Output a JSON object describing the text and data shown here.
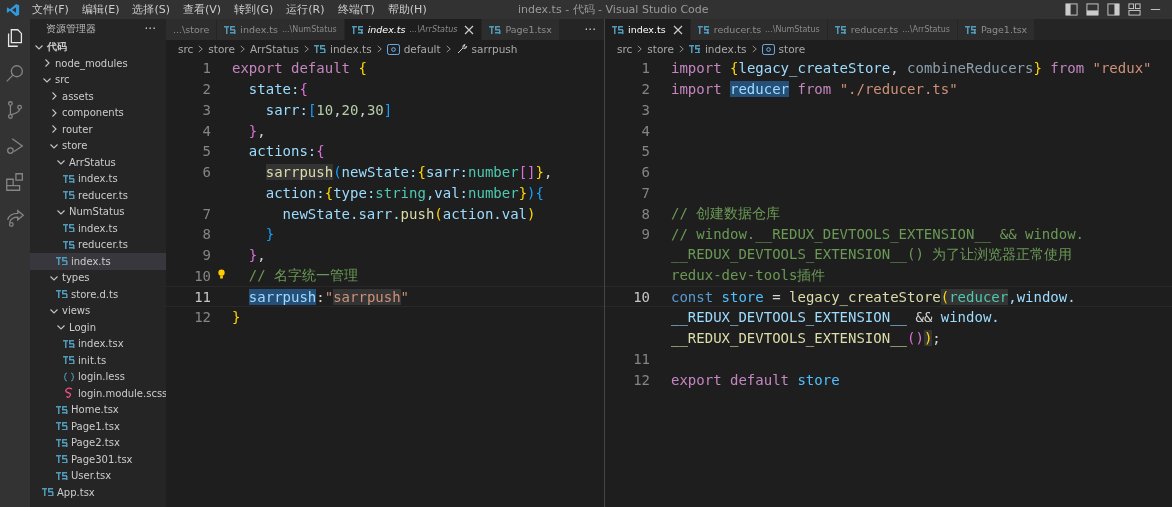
{
  "window": {
    "title": "index.ts - 代码 - Visual Studio Code"
  },
  "menu": [
    "文件(F)",
    "编辑(E)",
    "选择(S)",
    "查看(V)",
    "转到(G)",
    "运行(R)",
    "终端(T)",
    "帮助(H)"
  ],
  "activity_bar": [
    {
      "kind": "explorer",
      "selected": true
    },
    {
      "kind": "search",
      "selected": false
    },
    {
      "kind": "source-control",
      "selected": false
    },
    {
      "kind": "run",
      "selected": false
    },
    {
      "kind": "extensions",
      "selected": false
    },
    {
      "kind": "share",
      "selected": false
    }
  ],
  "sidebar": {
    "title": "资源管理器",
    "more": "···",
    "root": {
      "name": "代码",
      "expanded": true
    },
    "tree": [
      {
        "name": "node_modules",
        "kind": "folder",
        "expanded": false,
        "selected": false
      },
      {
        "name": "src",
        "kind": "folder",
        "expanded": true,
        "selected": false,
        "children": [
          {
            "name": "assets",
            "kind": "folder",
            "expanded": false,
            "selected": false
          },
          {
            "name": "components",
            "kind": "folder",
            "expanded": false,
            "selected": false
          },
          {
            "name": "router",
            "kind": "folder",
            "expanded": false,
            "selected": false
          },
          {
            "name": "store",
            "kind": "folder",
            "expanded": true,
            "selected": false,
            "children": [
              {
                "name": "ArrStatus",
                "kind": "folder",
                "expanded": true,
                "selected": false,
                "children": [
                  {
                    "name": "index.ts",
                    "kind": "ts",
                    "selected": false
                  },
                  {
                    "name": "reducer.ts",
                    "kind": "ts",
                    "selected": false
                  }
                ]
              },
              {
                "name": "NumStatus",
                "kind": "folder",
                "expanded": true,
                "selected": false,
                "children": [
                  {
                    "name": "index.ts",
                    "kind": "ts",
                    "selected": false
                  },
                  {
                    "name": "reducer.ts",
                    "kind": "ts",
                    "selected": false
                  }
                ]
              },
              {
                "name": "index.ts",
                "kind": "ts",
                "selected": true
              }
            ]
          },
          {
            "name": "types",
            "kind": "folder",
            "expanded": true,
            "selected": false,
            "children": [
              {
                "name": "store.d.ts",
                "kind": "ts",
                "selected": false
              }
            ]
          },
          {
            "name": "views",
            "kind": "folder",
            "expanded": true,
            "selected": false,
            "children": [
              {
                "name": "Login",
                "kind": "folder",
                "expanded": true,
                "selected": false,
                "children": [
                  {
                    "name": "index.tsx",
                    "kind": "ts",
                    "selected": false
                  },
                  {
                    "name": "init.ts",
                    "kind": "ts",
                    "selected": false
                  },
                  {
                    "name": "login.less",
                    "kind": "less",
                    "selected": false
                  },
                  {
                    "name": "login.module.scss",
                    "kind": "scss",
                    "selected": false
                  }
                ]
              },
              {
                "name": "Home.tsx",
                "kind": "ts",
                "selected": false
              },
              {
                "name": "Page1.tsx",
                "kind": "ts",
                "selected": false
              },
              {
                "name": "Page2.tsx",
                "kind": "ts",
                "selected": false
              },
              {
                "name": "Page301.tsx",
                "kind": "ts",
                "selected": false
              },
              {
                "name": "User.tsx",
                "kind": "ts",
                "selected": false
              }
            ]
          }
        ]
      },
      {
        "name": "App.tsx",
        "kind": "ts",
        "selected": false
      }
    ]
  },
  "editors": [
    {
      "tabs": [
        {
          "name": "...\\store",
          "icon": false,
          "selected": false,
          "preview": false
        },
        {
          "name": "index.ts",
          "path": "...\\NumStatus",
          "icon": true,
          "selected": false,
          "preview": false
        },
        {
          "name": "index.ts",
          "path": "...\\ArrStatus",
          "icon": true,
          "selected": true,
          "preview": true
        },
        {
          "name": "Page1.tsx",
          "icon": true,
          "selected": false,
          "preview": false
        }
      ],
      "more": "···",
      "breadcrumbs": [
        {
          "text": "src",
          "kind": "folder"
        },
        {
          "text": "store",
          "kind": "folder"
        },
        {
          "text": "ArrStatus",
          "kind": "folder"
        },
        {
          "text": "index.ts",
          "kind": "ts"
        },
        {
          "text": "default",
          "kind": "symbol"
        },
        {
          "text": "sarrpush",
          "kind": "property"
        }
      ],
      "lines": [
        {
          "number": "1",
          "current": false,
          "rows": [
            {
              "tokens": [
                {
                  "text": "export default ",
                  "kind": "kw"
                },
                {
                  "text": "{",
                  "kind": "b1"
                }
              ]
            }
          ]
        },
        {
          "number": "2",
          "current": false,
          "rows": [
            {
              "tokens": [
                {
                  "text": "  state:",
                  "kind": "var"
                },
                {
                  "text": "{",
                  "kind": "b2"
                }
              ]
            }
          ]
        },
        {
          "number": "3",
          "current": false,
          "rows": [
            {
              "tokens": [
                {
                  "text": "    sarr:",
                  "kind": "var"
                },
                {
                  "text": "[",
                  "kind": "b3"
                },
                {
                  "text": "10",
                  "kind": "num"
                },
                {
                  "text": ",",
                  "kind": "plain"
                },
                {
                  "text": "20",
                  "kind": "num"
                },
                {
                  "text": ",",
                  "kind": "plain"
                },
                {
                  "text": "30",
                  "kind": "num"
                },
                {
                  "text": "]",
                  "kind": "b3"
                }
              ]
            }
          ]
        },
        {
          "number": "4",
          "current": false,
          "rows": [
            {
              "tokens": [
                {
                  "text": "  }",
                  "kind": "b2"
                },
                {
                  "text": ",",
                  "kind": "plain"
                }
              ]
            }
          ]
        },
        {
          "number": "5",
          "current": false,
          "rows": [
            {
              "tokens": [
                {
                  "text": "  actions:",
                  "kind": "var"
                },
                {
                  "text": "{",
                  "kind": "b2"
                }
              ]
            }
          ]
        },
        {
          "number": "6",
          "current": false,
          "rows": [
            {
              "tokens": [
                {
                  "text": "    sarrpush",
                  "kind": "fn-hl"
                },
                {
                  "text": "(",
                  "kind": "b3"
                },
                {
                  "text": "newState:",
                  "kind": "var"
                },
                {
                  "text": "{",
                  "kind": "b1"
                },
                {
                  "text": "sarr:",
                  "kind": "var"
                },
                {
                  "text": "number",
                  "kind": "type"
                },
                {
                  "text": "[]",
                  "kind": "b2"
                },
                {
                  "text": "}",
                  "kind": "b1"
                },
                {
                  "text": ",",
                  "kind": "plain"
                }
              ]
            },
            {
              "tokens": [
                {
                  "text": "    action:",
                  "kind": "var"
                },
                {
                  "text": "{",
                  "kind": "b1"
                },
                {
                  "text": "type:",
                  "kind": "var"
                },
                {
                  "text": "string",
                  "kind": "type"
                },
                {
                  "text": ",val:",
                  "kind": "var"
                },
                {
                  "text": "number",
                  "kind": "type"
                },
                {
                  "text": "}",
                  "kind": "b1"
                },
                {
                  "text": ")",
                  "kind": "b3"
                },
                {
                  "text": "{",
                  "kind": "b3"
                }
              ]
            }
          ]
        },
        {
          "number": "7",
          "current": false,
          "rows": [
            {
              "tokens": [
                {
                  "text": "      newState.sarr.",
                  "kind": "var"
                },
                {
                  "text": "push",
                  "kind": "fn"
                },
                {
                  "text": "(",
                  "kind": "b1"
                },
                {
                  "text": "action.val",
                  "kind": "var"
                },
                {
                  "text": ")",
                  "kind": "b1"
                }
              ]
            }
          ]
        },
        {
          "number": "8",
          "current": false,
          "rows": [
            {
              "tokens": [
                {
                  "text": "    }",
                  "kind": "b3"
                }
              ]
            }
          ]
        },
        {
          "number": "9",
          "current": false,
          "rows": [
            {
              "tokens": [
                {
                  "text": "  }",
                  "kind": "b2"
                },
                {
                  "text": ",",
                  "kind": "plain"
                }
              ]
            }
          ]
        },
        {
          "number": "10",
          "current": false,
          "bulb": true,
          "rows": [
            {
              "tokens": [
                {
                  "text": "  // 名字统一管理",
                  "kind": "cmt"
                }
              ]
            }
          ]
        },
        {
          "number": "11",
          "current": true,
          "rows": [
            {
              "tokens": [
                {
                  "text": "  sarrpush",
                  "kind": "var-sel"
                },
                {
                  "text": ":",
                  "kind": "plain"
                },
                {
                  "text": "\"",
                  "kind": "str"
                },
                {
                  "text": "sarrpush",
                  "kind": "str-hl"
                },
                {
                  "text": "\"",
                  "kind": "str"
                }
              ]
            }
          ]
        },
        {
          "number": "12",
          "current": false,
          "rows": [
            {
              "tokens": [
                {
                  "text": "}",
                  "kind": "b1"
                }
              ]
            }
          ]
        }
      ]
    },
    {
      "tabs": [
        {
          "name": "index.ts",
          "icon": true,
          "selected": true,
          "preview": false
        },
        {
          "name": "reducer.ts",
          "path": "...\\NumStatus",
          "icon": true,
          "selected": false,
          "preview": false
        },
        {
          "name": "reducer.ts",
          "path": "...\\ArrStatus",
          "icon": true,
          "selected": false,
          "preview": false
        },
        {
          "name": "Page1.tsx",
          "icon": true,
          "selected": false,
          "preview": false
        }
      ],
      "breadcrumbs": [
        {
          "text": "src",
          "kind": "folder"
        },
        {
          "text": "store",
          "kind": "folder"
        },
        {
          "text": "index.ts",
          "kind": "ts"
        },
        {
          "text": "store",
          "kind": "symbol"
        }
      ],
      "lines": [
        {
          "number": "1",
          "current": false,
          "rows": [
            {
              "tokens": [
                {
                  "text": "import ",
                  "kind": "kw"
                },
                {
                  "text": "{",
                  "kind": "b1"
                },
                {
                  "text": "legacy_createStore",
                  "kind": "var"
                },
                {
                  "text": ", ",
                  "kind": "plain"
                },
                {
                  "text": "combineReducers",
                  "kind": "dim"
                },
                {
                  "text": "}",
                  "kind": "b1"
                },
                {
                  "text": " from ",
                  "kind": "kw"
                },
                {
                  "text": "\"redux\"",
                  "kind": "str"
                }
              ]
            }
          ]
        },
        {
          "number": "2",
          "current": false,
          "rows": [
            {
              "tokens": [
                {
                  "text": "import ",
                  "kind": "kw"
                },
                {
                  "text": "reducer",
                  "kind": "var-sel"
                },
                {
                  "text": " from ",
                  "kind": "kw"
                },
                {
                  "text": "\"./reducer.ts\"",
                  "kind": "str"
                }
              ]
            }
          ]
        },
        {
          "number": "3",
          "current": false
        },
        {
          "number": "4",
          "current": false
        },
        {
          "number": "5",
          "current": false
        },
        {
          "number": "6",
          "current": false
        },
        {
          "number": "7",
          "current": false
        },
        {
          "number": "8",
          "current": false,
          "rows": [
            {
              "tokens": [
                {
                  "text": "// 创建数据仓库",
                  "kind": "cmt"
                }
              ]
            }
          ]
        },
        {
          "number": "9",
          "current": false,
          "rows": [
            {
              "tokens": [
                {
                  "text": "// window.__REDUX_DEVTOOLS_EXTENSION__ && window.",
                  "kind": "cmt"
                }
              ]
            },
            {
              "tokens": [
                {
                  "text": "__REDUX_DEVTOOLS_EXTENSION__() 为了让浏览器正常使用",
                  "kind": "cmt"
                }
              ]
            },
            {
              "tokens": [
                {
                  "text": "redux-dev-tools插件",
                  "kind": "cmt"
                }
              ]
            }
          ]
        },
        {
          "number": "10",
          "current": true,
          "rows": [
            {
              "tokens": [
                {
                  "text": "const ",
                  "kind": "kw2"
                },
                {
                  "text": "store",
                  "kind": "const"
                },
                {
                  "text": " = ",
                  "kind": "plain"
                },
                {
                  "text": "legacy_createStore",
                  "kind": "fn"
                },
                {
                  "text": "(",
                  "kind": "b1-hl"
                },
                {
                  "text": "reducer",
                  "kind": "type-hl"
                },
                {
                  "text": ",window.",
                  "kind": "var"
                }
              ]
            },
            {
              "tokens": [
                {
                  "text": "__REDUX_DEVTOOLS_EXTENSION__",
                  "kind": "var"
                },
                {
                  "text": " && ",
                  "kind": "plain"
                },
                {
                  "text": "window.",
                  "kind": "var"
                }
              ]
            },
            {
              "tokens": [
                {
                  "text": "__REDUX_DEVTOOLS_EXTENSION__",
                  "kind": "fn"
                },
                {
                  "text": "()",
                  "kind": "b2"
                },
                {
                  "text": ")",
                  "kind": "b1-hl"
                },
                {
                  "text": ";",
                  "kind": "plain"
                }
              ]
            }
          ]
        },
        {
          "number": "11",
          "current": false
        },
        {
          "number": "12",
          "current": false,
          "rows": [
            {
              "tokens": [
                {
                  "text": "export default ",
                  "kind": "kw"
                },
                {
                  "text": "store",
                  "kind": "const"
                }
              ]
            }
          ]
        }
      ]
    }
  ]
}
